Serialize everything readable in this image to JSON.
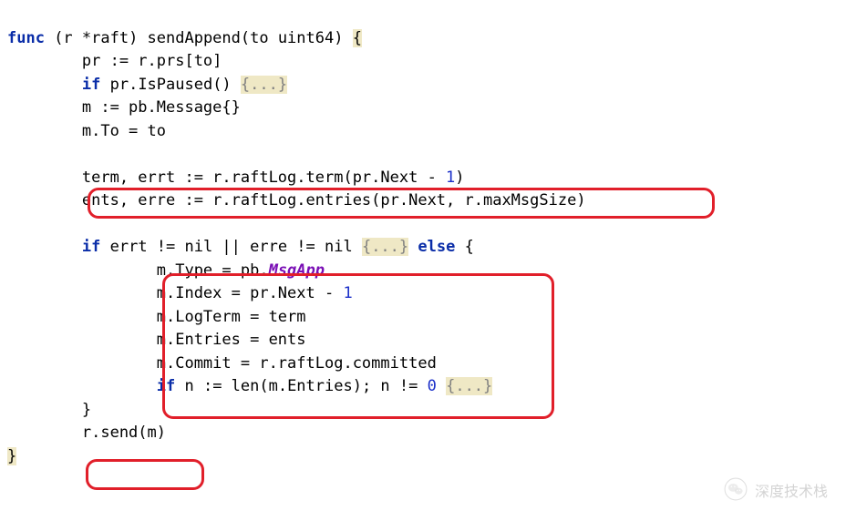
{
  "code": {
    "l1_func": "func",
    "l1_rest": " (r *raft) sendAppend(to uint64) ",
    "l1_brace": "{",
    "l2": "        pr := r.prs[to]",
    "l3a": "        ",
    "l3_if": "if",
    "l3b": " pr.IsPaused() ",
    "l3_fold": "{...}",
    "l4": "        m := pb.Message{}",
    "l5": "        m.To = to",
    "blank1": "",
    "l6a": "        term, errt := r.raftLog.term(pr.Next - ",
    "l6_num": "1",
    "l6b": ")",
    "l7": "        ents, erre := r.raftLog.entries(pr.Next, r.maxMsgSize)",
    "blank2": "",
    "l8a": "        ",
    "l8_if": "if",
    "l8b": " errt != nil || erre != nil ",
    "l8_fold": "{...}",
    "l8c": " ",
    "l8_else": "else",
    "l8d": " {",
    "l9a": "                m.Type = pb.",
    "l9_type": "MsgApp",
    "l10a": "                m.Index = pr.Next - ",
    "l10_num": "1",
    "l11": "                m.LogTerm = term",
    "l12": "                m.Entries = ents",
    "l13": "                m.Commit = r.raftLog.committed",
    "l14a": "                ",
    "l14_if": "if",
    "l14b": " n := len(m.Entries); n != ",
    "l14_num": "0",
    "l14c": " ",
    "l14_fold": "{...}",
    "l15": "        }",
    "l16": "        r.send(m)",
    "l17": "}"
  },
  "watermark": {
    "text": "深度技术栈"
  },
  "highlights": {
    "box1_desc": "ents-erre-assignment-line",
    "box2_desc": "message-assignment-block",
    "box3_desc": "r-send-m-call"
  }
}
